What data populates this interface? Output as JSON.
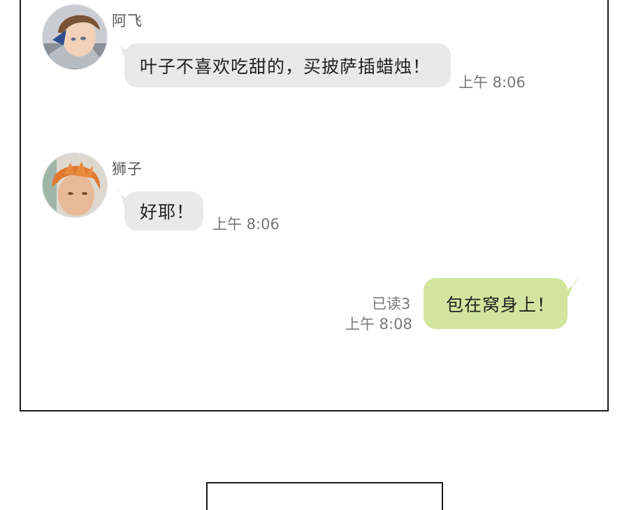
{
  "messages": [
    {
      "sender": "阿飞",
      "avatar": "avatar-brown-hair-man",
      "text": "叶子不喜欢吃甜的，买披萨插蜡烛！",
      "time": "上午 8:06",
      "direction": "incoming"
    },
    {
      "sender": "狮子",
      "avatar": "avatar-orange-hair-man",
      "text": "好耶！",
      "time": "上午 8:06",
      "direction": "incoming"
    },
    {
      "text": "包在窝身上！",
      "time": "上午 8:08",
      "read_status": "已读3",
      "direction": "outgoing"
    }
  ],
  "colors": {
    "incoming_bubble": "#e9e9e9",
    "outgoing_bubble": "#d1e59e",
    "border": "#1a1a1a"
  }
}
